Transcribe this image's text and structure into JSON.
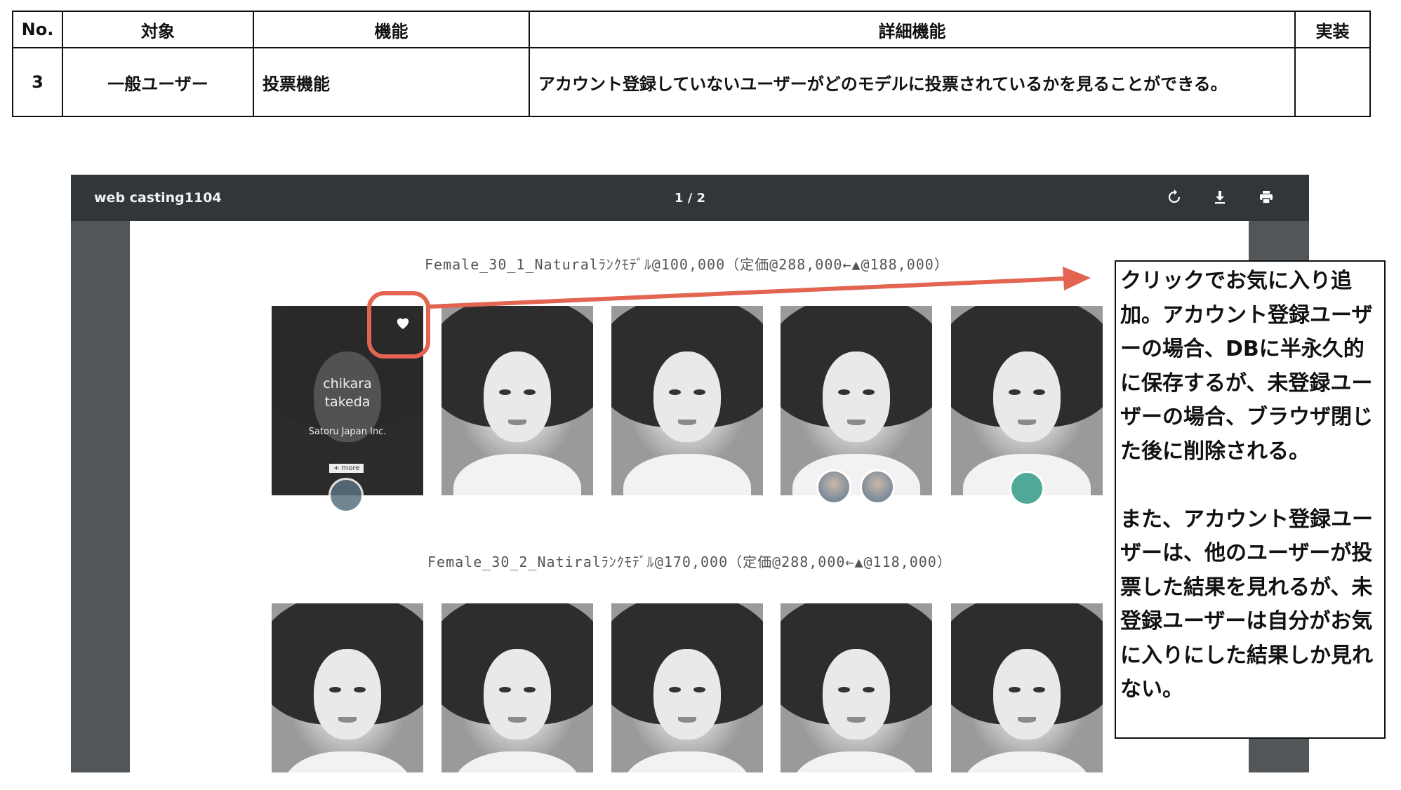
{
  "spec_table": {
    "headers": {
      "no": "No.",
      "target": "対象",
      "function": "機能",
      "detail": "詳細機能",
      "implemented": "実装"
    },
    "row": {
      "no": "3",
      "target": "一般ユーザー",
      "function": "投票機能",
      "detail": "アカウント登録していないユーザーがどのモデルに投票されているかを見ることができる。",
      "implemented": ""
    }
  },
  "viewer": {
    "doc_title": "web casting1104",
    "page_indicator": "1 / 2",
    "toolbar": {
      "rotate_icon": "rotate-icon",
      "download_icon": "download-icon",
      "print_icon": "print-icon"
    }
  },
  "sections": [
    {
      "title": "Female_30_1_Naturalﾗﾝｸﾓﾃﾞﾙ@100,000（定価@288,000←▲@188,000）"
    },
    {
      "title": "Female_30_2_Natiralﾗﾝｸﾓﾃﾞﾙ@170,000（定価@288,000←▲@118,000）"
    }
  ],
  "hover_card": {
    "name_line1": "chikara",
    "name_line2": "takeda",
    "agency": "Satoru Japan Inc.",
    "more": "+ more",
    "heart_icon": "heart-icon"
  },
  "annotation": {
    "note": "クリックでお気に入り追加。アカウント登録ユーザーの場合、DBに半永久的に保存するが、未登録ユーザーの場合、ブラウザ閉じた後に削除される。\n\nまた、アカウント登録ユーザーは、他のユーザーが投票した結果を見れるが、未登録ユーザーは自分がお気に入りにした結果しか見れない。",
    "highlight_color": "#e26451"
  }
}
